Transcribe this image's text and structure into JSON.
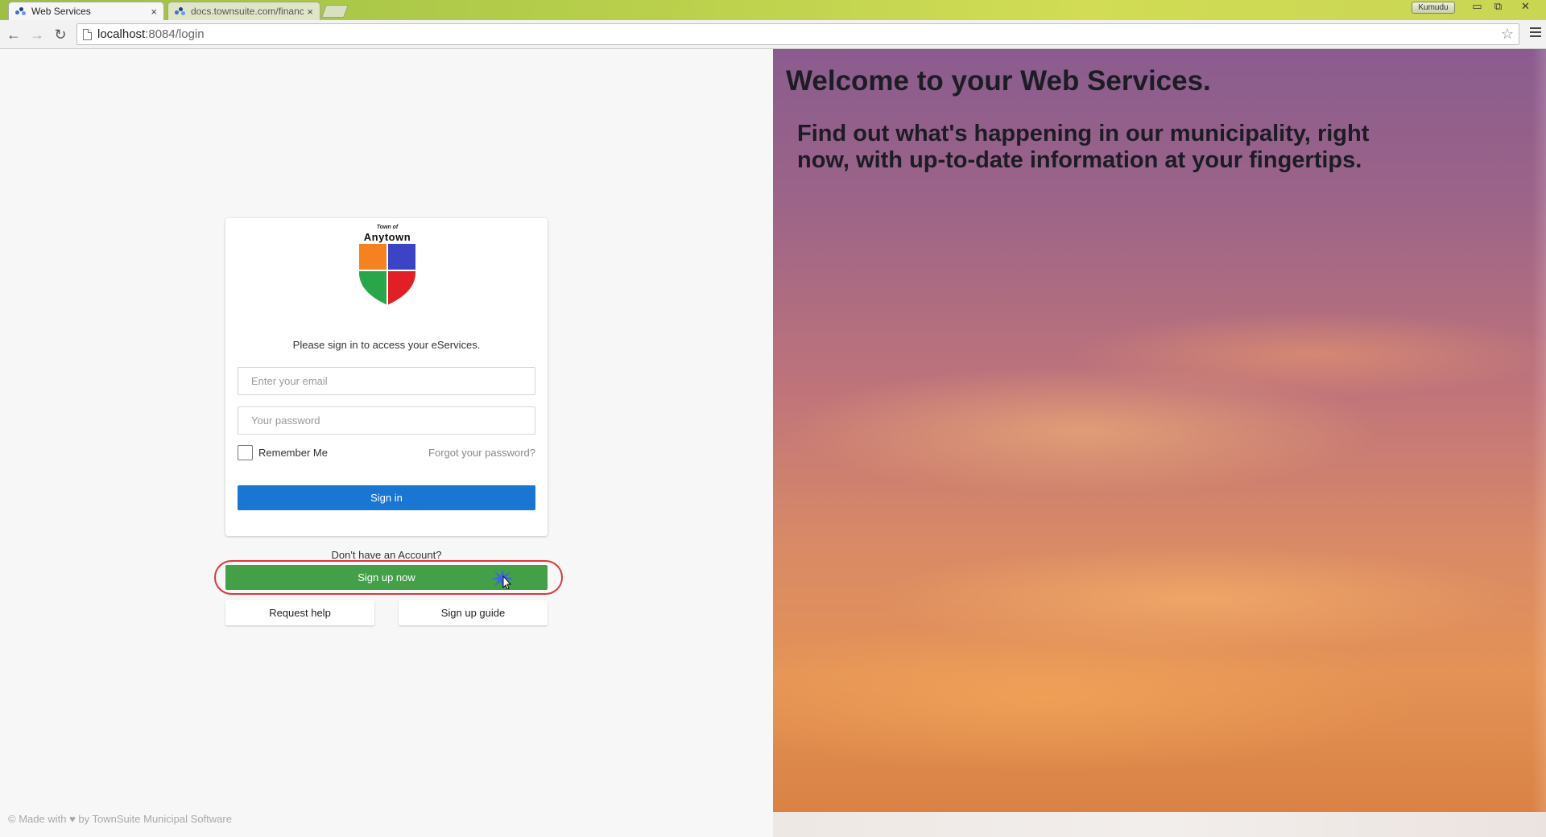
{
  "browser": {
    "tabs": [
      {
        "label": "Web Services",
        "close": "×"
      },
      {
        "label": "docs.townsuite.com/financ",
        "close": "×"
      }
    ],
    "user_badge": "Kumudu",
    "window_controls": {
      "minimize": "▭",
      "restore": "⧉",
      "close": "✕"
    },
    "nav": {
      "back": "←",
      "forward": "→",
      "reload": "↻"
    },
    "address": {
      "host": "localhost",
      "rest": ":8084/login"
    },
    "star": "☆"
  },
  "hero": {
    "title": "Welcome to your Web Services.",
    "subtitle": "Find out what's happening in our municipality, right now, with up-to-date information at your fingertips."
  },
  "logo": {
    "town_of": "Town of",
    "name": "Anytown"
  },
  "login": {
    "prompt": "Please sign in to access your eServices.",
    "email_placeholder": "Enter your email",
    "password_placeholder": "Your password",
    "remember_label": "Remember Me",
    "forgot_label": "Forgot your password?",
    "signin_label": "Sign in"
  },
  "signup": {
    "question": "Don't have an Account?",
    "button_label": "Sign up now",
    "request_help_label": "Request help",
    "guide_label": "Sign up guide"
  },
  "footer": {
    "prefix": "© Made with",
    "heart": "♥",
    "suffix": "by TownSuite Municipal Software"
  },
  "colors": {
    "primary": "#1976d2",
    "success": "#43a047",
    "highlight": "#d9393b"
  }
}
